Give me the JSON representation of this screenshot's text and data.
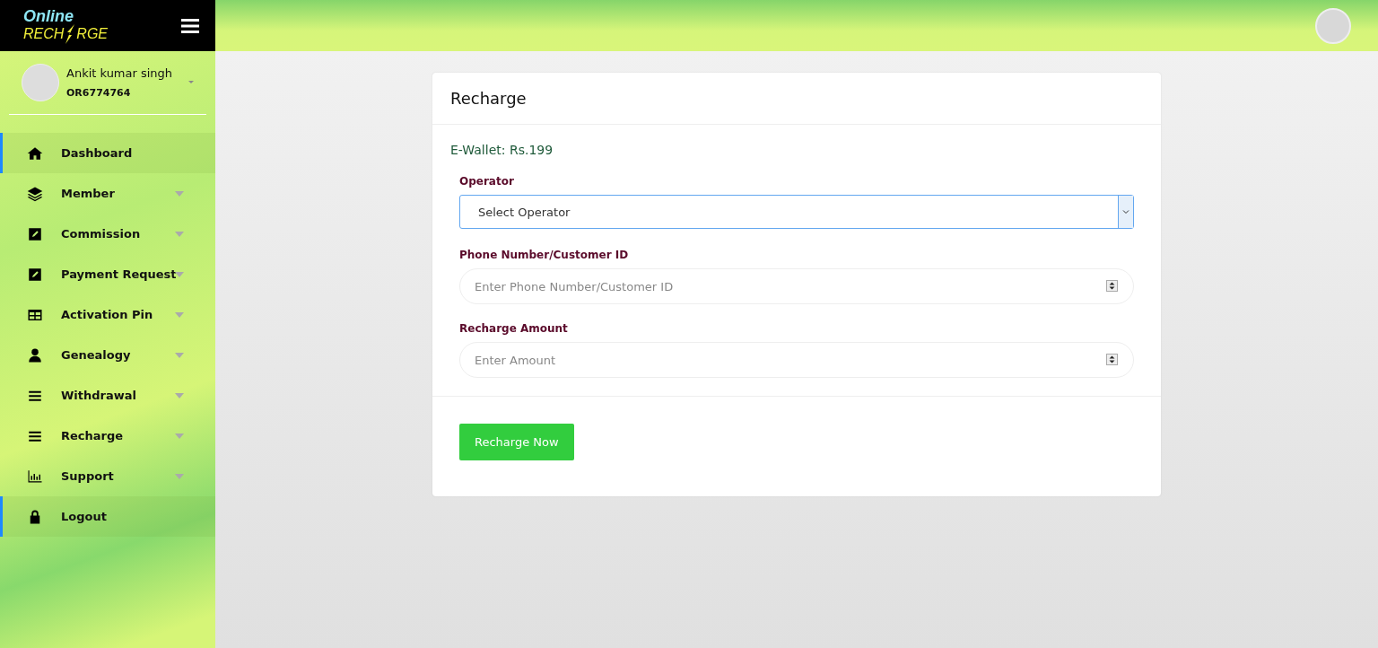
{
  "logo": {
    "top": "Online",
    "bottom_left": "RECH",
    "bottom_right": "RGE"
  },
  "user": {
    "name": "Ankit kumar singh",
    "id": "OR6774764"
  },
  "sidebar": {
    "items": [
      {
        "label": "Dashboard",
        "active": true,
        "expandable": false
      },
      {
        "label": "Member",
        "active": false,
        "expandable": true
      },
      {
        "label": "Commission",
        "active": false,
        "expandable": true
      },
      {
        "label": "Payment Request",
        "active": false,
        "expandable": true
      },
      {
        "label": "Activation Pin",
        "active": false,
        "expandable": true
      },
      {
        "label": "Genealogy",
        "active": false,
        "expandable": true
      },
      {
        "label": "Withdrawal",
        "active": false,
        "expandable": true
      },
      {
        "label": "Recharge",
        "active": false,
        "expandable": true
      },
      {
        "label": "Support",
        "active": false,
        "expandable": true
      },
      {
        "label": "Logout",
        "active": true,
        "expandable": false
      }
    ]
  },
  "card": {
    "title": "Recharge",
    "wallet": "E-Wallet: Rs.199",
    "fields": [
      {
        "kind": "select",
        "label": "Operator",
        "value": "Select Operator"
      },
      {
        "kind": "number",
        "label": "Phone Number/Customer ID",
        "placeholder": "Enter Phone Number/Customer ID"
      },
      {
        "kind": "number",
        "label": "Recharge Amount",
        "placeholder": "Enter Amount"
      }
    ],
    "button": "Recharge Now"
  }
}
